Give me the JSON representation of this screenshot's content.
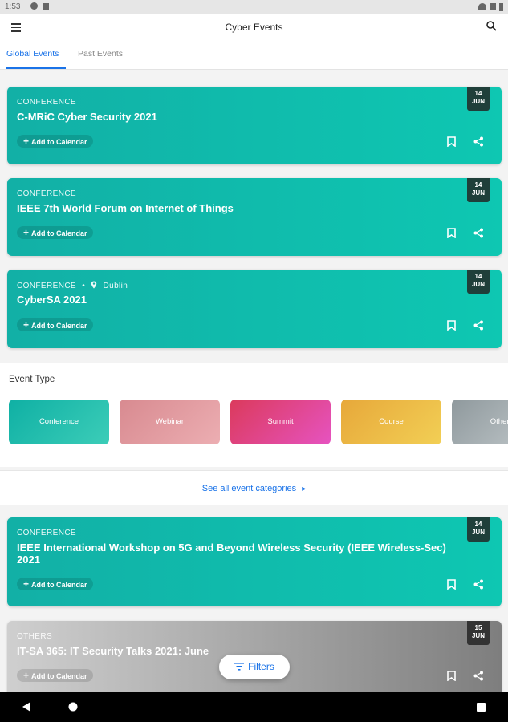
{
  "status": {
    "time": "1:53"
  },
  "app": {
    "title": "Cyber Events",
    "menu_icon": "menu-icon",
    "search_icon": "search-icon"
  },
  "tabs": [
    {
      "label": "Global Events",
      "active": true
    },
    {
      "label": "Past Events",
      "active": false
    }
  ],
  "events": [
    {
      "category": "CONFERENCE",
      "title": "C-MRiC Cyber Security 2021",
      "day": "14",
      "month": "JUN",
      "add_label": "Add to Calendar"
    },
    {
      "category": "CONFERENCE",
      "title": "IEEE 7th World Forum on Internet of Things",
      "day": "14",
      "month": "JUN",
      "add_label": "Add to Calendar"
    },
    {
      "category": "CONFERENCE",
      "location": "Dublin",
      "title": "CyberSA 2021",
      "day": "14",
      "month": "JUN",
      "add_label": "Add to Calendar"
    }
  ],
  "event_type": {
    "title": "Event Type",
    "tiles": [
      {
        "label": "Conference",
        "color": "#16b9ac"
      },
      {
        "label": "Webinar",
        "color": "#e39a9f"
      },
      {
        "label": "Summit",
        "color": "#e0476f"
      },
      {
        "label": "Course",
        "color": "#ecbd3f"
      },
      {
        "label": "Others",
        "color": "#9aa3a6"
      }
    ]
  },
  "see_all": {
    "label": "See all event categories"
  },
  "more_events": [
    {
      "category": "CONFERENCE",
      "title": "IEEE International Workshop on 5G and Beyond Wireless Security (IEEE Wireless-Sec) 2021",
      "day": "14",
      "month": "JUN",
      "add_label": "Add to Calendar"
    },
    {
      "category": "OTHERS",
      "title": "IT-SA 365: IT Security Talks 2021: June",
      "day": "15",
      "month": "JUN",
      "add_label": "Add to Calendar"
    }
  ],
  "fab": {
    "label": "Filters"
  }
}
